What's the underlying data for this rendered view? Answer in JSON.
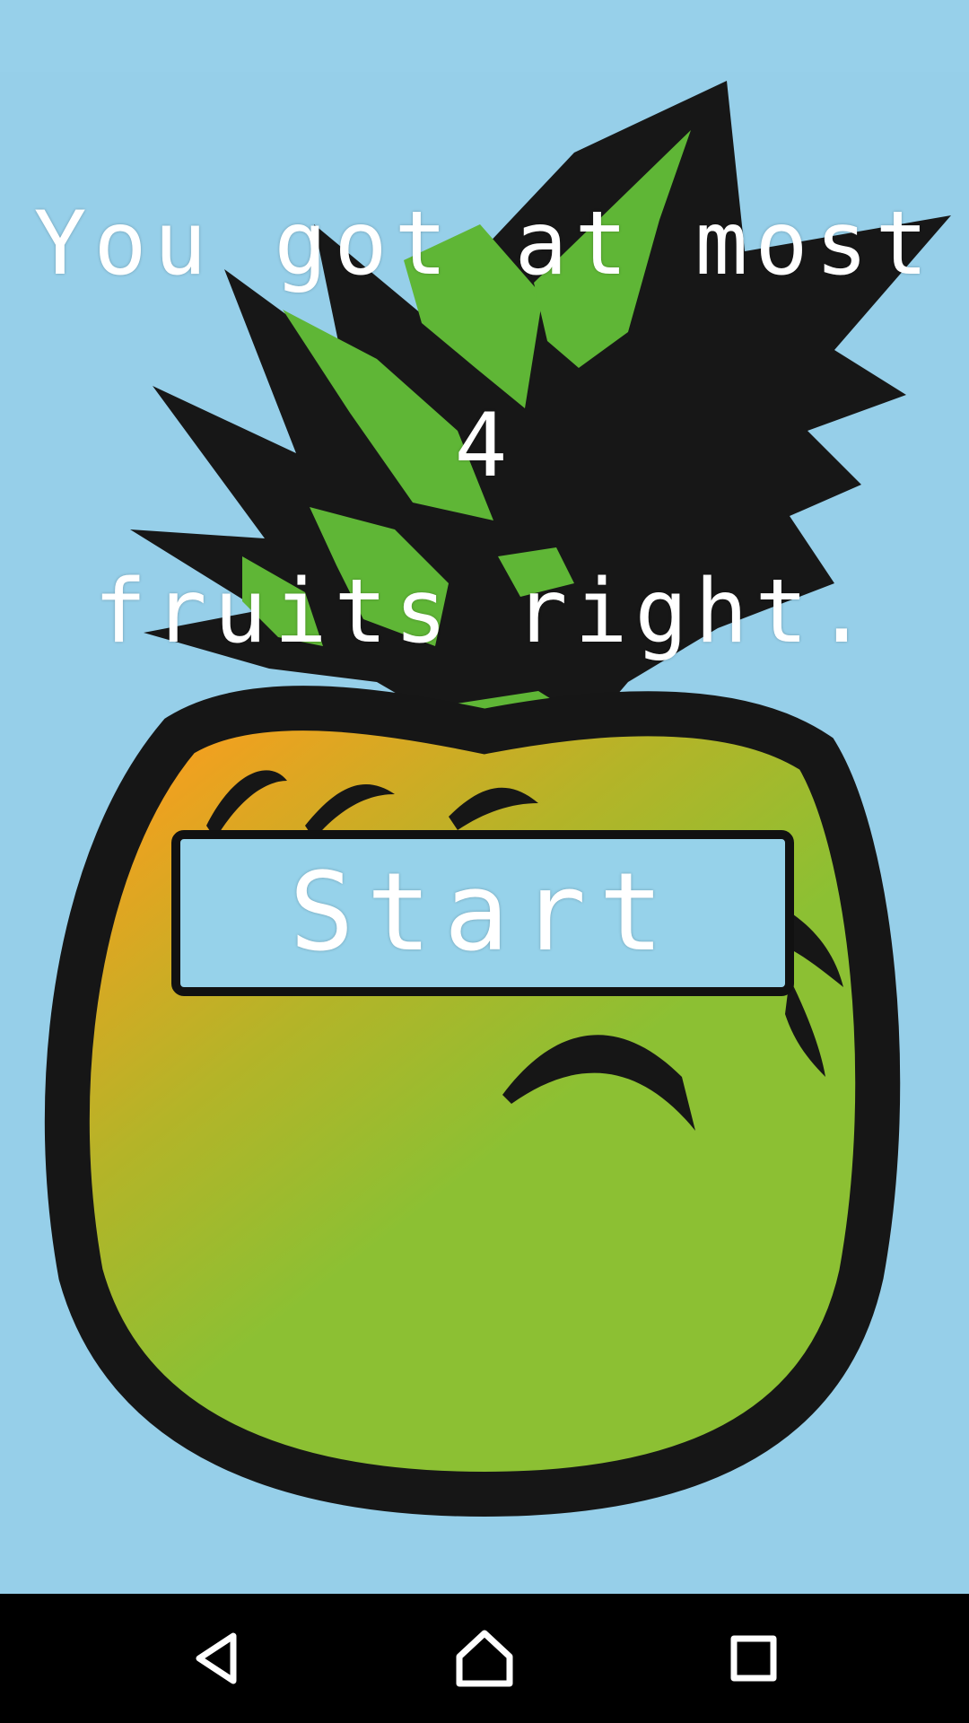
{
  "result": {
    "line1": "You got at most",
    "count": "4",
    "line3": "fruits right."
  },
  "start_button": {
    "label": "Start"
  },
  "navigation": {
    "back": "back-icon",
    "home": "home-icon",
    "recents": "recents-icon"
  },
  "colors": {
    "background": "#96cfe9",
    "leaf_green": "#5fb636",
    "outline": "#161616",
    "fruit_orange": "#f0a224",
    "fruit_green": "#8cc033",
    "text": "#ffffff"
  }
}
